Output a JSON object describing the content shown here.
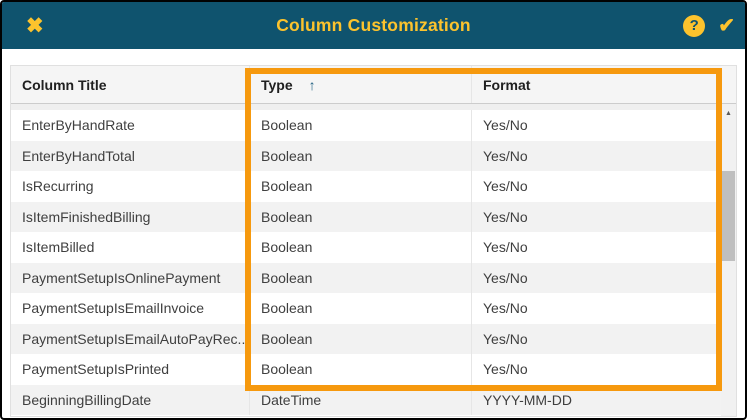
{
  "window": {
    "title": "Column Customization"
  },
  "titlebar": {
    "close_icon": "✖",
    "help_icon": "?",
    "confirm_icon": "✔"
  },
  "table": {
    "headers": {
      "column_title": "Column Title",
      "type": "Type",
      "format": "Format"
    },
    "sort_icon": "↑",
    "sorted_column": "Type",
    "rows": [
      {
        "title": "EnterByHandRate",
        "type": "Boolean",
        "format": "Yes/No"
      },
      {
        "title": "EnterByHandTotal",
        "type": "Boolean",
        "format": "Yes/No"
      },
      {
        "title": "IsRecurring",
        "type": "Boolean",
        "format": "Yes/No"
      },
      {
        "title": "IsItemFinishedBilling",
        "type": "Boolean",
        "format": "Yes/No"
      },
      {
        "title": "IsItemBilled",
        "type": "Boolean",
        "format": "Yes/No"
      },
      {
        "title": "PaymentSetupIsOnlinePayment",
        "type": "Boolean",
        "format": "Yes/No"
      },
      {
        "title": "PaymentSetupIsEmailInvoice",
        "type": "Boolean",
        "format": "Yes/No"
      },
      {
        "title": "PaymentSetupIsEmailAutoPayRec...",
        "type": "Boolean",
        "format": "Yes/No"
      },
      {
        "title": "PaymentSetupIsPrinted",
        "type": "Boolean",
        "format": "Yes/No"
      },
      {
        "title": "BeginningBillingDate",
        "type": "DateTime",
        "format": "YYYY-MM-DD"
      }
    ]
  },
  "scrollbar": {
    "up_icon": "▲"
  },
  "colors": {
    "titlebar_bg": "#0f536e",
    "accent_yellow": "#fcc32d",
    "highlight_orange": "#f6990e",
    "alt_row_bg": "#f2f2f2"
  }
}
